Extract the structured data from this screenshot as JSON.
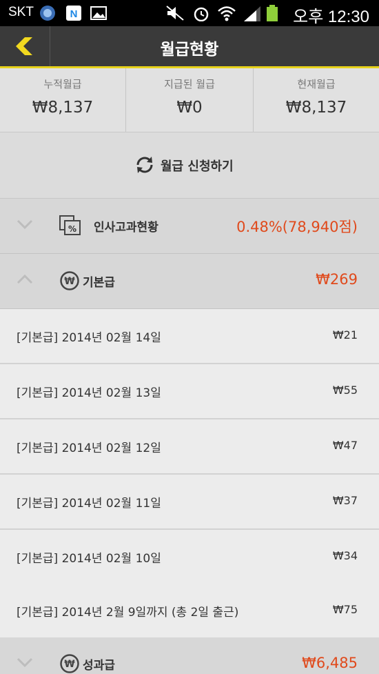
{
  "status": {
    "carrier": "SKT",
    "time": "오후 12:30"
  },
  "appbar": {
    "title": "월급현황"
  },
  "summary": [
    {
      "label": "누적월급",
      "value": "₩8,137"
    },
    {
      "label": "지급된 월급",
      "value": "₩0"
    },
    {
      "label": "현재월급",
      "value": "₩8,137"
    }
  ],
  "request": {
    "label": "월급 신청하기"
  },
  "sections": {
    "evaluation": {
      "label": "인사고과현황",
      "value": "0.48%(78,940점)"
    },
    "base": {
      "label": "기본급",
      "value": "₩269"
    },
    "performance": {
      "label": "성과급",
      "value": "₩6,485"
    }
  },
  "rows": [
    {
      "label": "[기본급] 2014년 02월 14일",
      "value": "₩21"
    },
    {
      "label": "[기본급] 2014년 02월 13일",
      "value": "₩55"
    },
    {
      "label": "[기본급] 2014년 02월 12일",
      "value": "₩47"
    },
    {
      "label": "[기본급] 2014년 02월 11일",
      "value": "₩37"
    },
    {
      "label": "[기본급] 2014년 02월 10일",
      "value": "₩34"
    },
    {
      "label": "[기본급] 2014년 2월 9일까지 (총 2일 출근)",
      "value": "₩75"
    }
  ],
  "colors": {
    "accent": "#e7d21b",
    "amount": "#e04a1c",
    "appbar": "#3a3a3a"
  }
}
